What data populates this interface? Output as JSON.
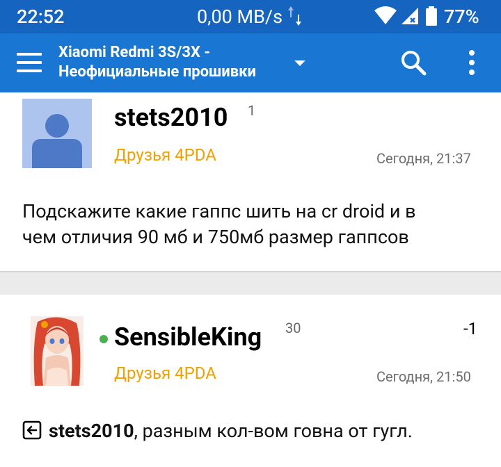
{
  "status_bar": {
    "time": "22:52",
    "network_speed": "0,00 MB/s",
    "battery_percent": "77%"
  },
  "app_bar": {
    "title_line1": "Xiaomi Redmi 3S/3X -",
    "title_line2": "Неофициальные прошивки",
    "icons": [
      "menu-icon",
      "dropdown-arrow-icon",
      "search-icon",
      "more-vertical-icon"
    ]
  },
  "posts": [
    {
      "author": "stets2010",
      "reputation": "1",
      "group": "Друзья 4PDA",
      "date": "Сегодня, 21:37",
      "text_line1": "Подскажите какие гаппс шить на cr droid и в",
      "text_line2": "чем отличия 90 мб и 750мб размер гаппсов"
    },
    {
      "author": "SensibleKing",
      "reputation": "30",
      "vote": "-1",
      "group": "Друзья 4PDA",
      "date": "Сегодня, 21:50",
      "quoted_user": "stets2010",
      "text": ", разным кол-вом говна от гугл."
    }
  ],
  "colors": {
    "status_bar": "#1565c0",
    "app_bar": "#1976d2",
    "group": "#f2a000",
    "online": "#4caf50",
    "background": "#ebebeb"
  }
}
